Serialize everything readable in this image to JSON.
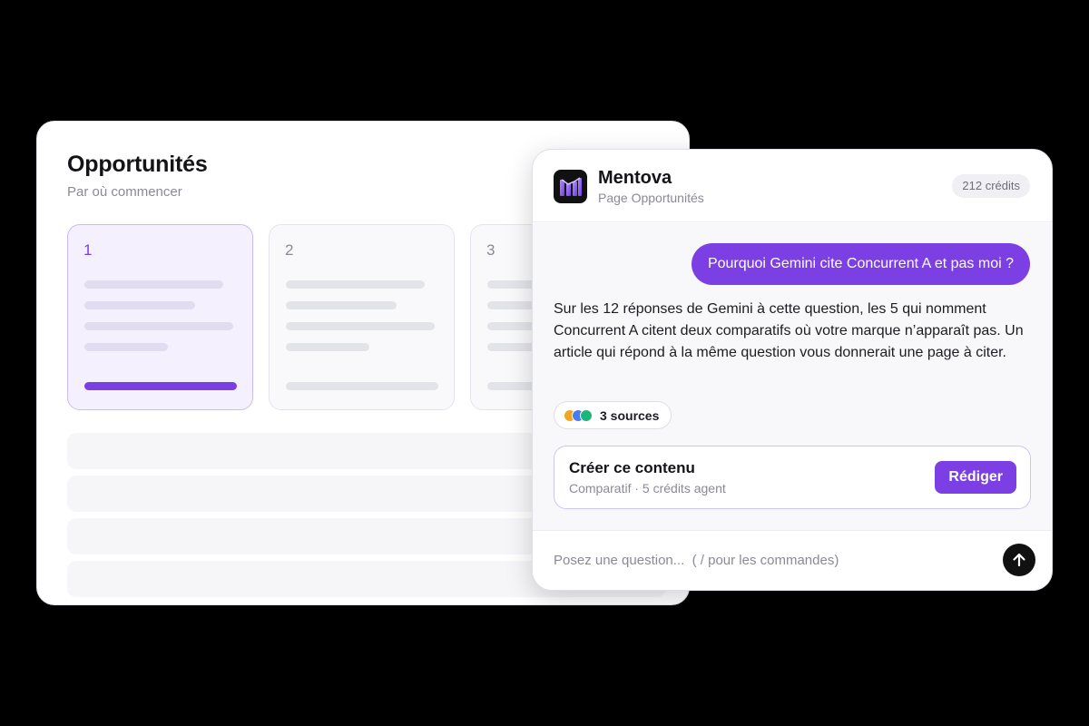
{
  "opportunities": {
    "title": "Opportunités",
    "subtitle": "Par où commencer",
    "steps": [
      {
        "number": "1",
        "active": true
      },
      {
        "number": "2",
        "active": false
      },
      {
        "number": "3",
        "active": false
      }
    ]
  },
  "chat": {
    "app_name": "Mentova",
    "page_name": "Page Opportunités",
    "credits": "212 crédits",
    "user_message": "Pourquoi Gemini cite Concurrent A et pas moi ?",
    "assistant_message": "Sur les 12 réponses de Gemini à cette question, les 5 qui nomment Concurrent A citent deux comparatifs où votre marque n’apparaît pas. Un article qui répond à la même question vous donnerait une page à citer.",
    "sources_label": "3 sources",
    "source_colors": [
      "#f0a623",
      "#4a7cf0",
      "#1fb47a"
    ],
    "action_title": "Créer ce contenu",
    "action_subtitle": "Comparatif · 5 crédits agent",
    "action_button": "Rédiger",
    "input_placeholder": "Posez une question...  ( / pour les commandes)"
  },
  "colors": {
    "accent": "#7b3fe4",
    "background": "#000000"
  },
  "icons": {
    "logo": "mentova-logo-icon",
    "send": "arrow-up-icon"
  }
}
